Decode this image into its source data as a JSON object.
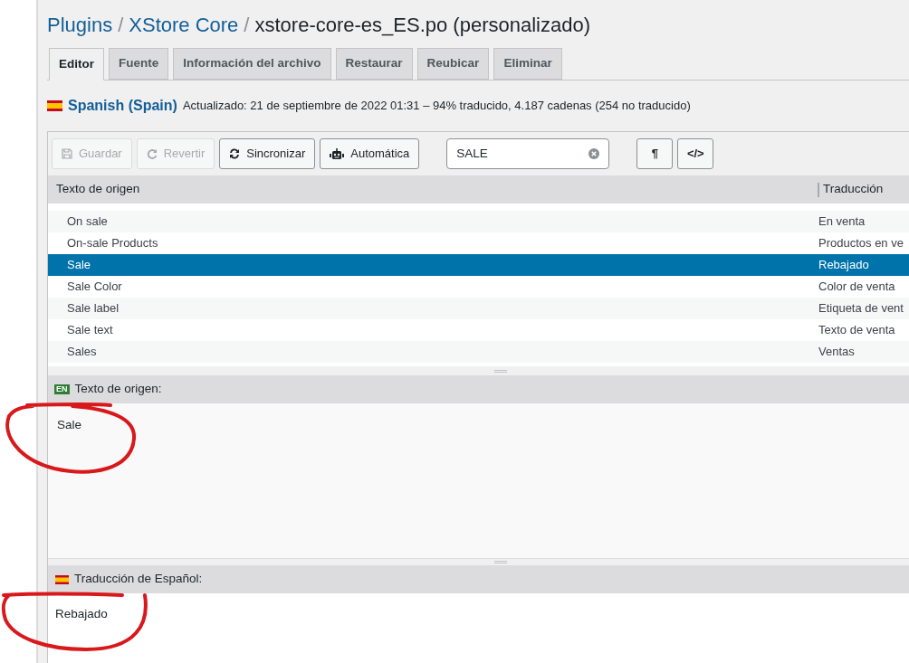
{
  "breadcrumb": [
    {
      "text": "Plugins",
      "kind": "link"
    },
    {
      "text": "/",
      "kind": "separator"
    },
    {
      "text": "XStore Core",
      "kind": "link"
    },
    {
      "text": "/",
      "kind": "separator"
    },
    {
      "text": "xstore-core-es_ES.po (personalizado)",
      "kind": "current"
    }
  ],
  "tabs": [
    {
      "label": "Editor",
      "selected": true
    },
    {
      "label": "Fuente",
      "selected": false
    },
    {
      "label": "Información del archivo",
      "selected": false
    },
    {
      "label": "Restaurar",
      "selected": false
    },
    {
      "label": "Reubicar",
      "selected": false
    },
    {
      "label": "Eliminar",
      "selected": false
    }
  ],
  "locale": {
    "name": "Spanish (Spain)",
    "summary": "Actualizado: 21 de septiembre de 2022 01:31 – 94% traducido, 4.187 cadenas (254 no traducido)"
  },
  "toolbar": {
    "buttons": [
      {
        "label": "Guardar",
        "kind": "save",
        "disabled": true
      },
      {
        "label": "Revertir",
        "kind": "revert",
        "disabled": true
      },
      {
        "label": "Sincronizar",
        "kind": "sync",
        "disabled": false
      },
      {
        "label": "Automática",
        "kind": "robot",
        "disabled": false
      }
    ],
    "search": {
      "value": "SALE"
    },
    "toggles": [
      "¶",
      "</>"
    ]
  },
  "table": {
    "columns": [
      "Texto de origen",
      "Traducción"
    ],
    "rows": [
      {
        "source": "On sale",
        "translation": "En venta",
        "selected": false
      },
      {
        "source": "On-sale Products",
        "translation": "Productos en ve",
        "selected": false
      },
      {
        "source": "Sale",
        "translation": "Rebajado",
        "selected": true
      },
      {
        "source": "Sale Color",
        "translation": "Color de venta",
        "selected": false
      },
      {
        "source": "Sale label",
        "translation": "Etiqueta de vent",
        "selected": false
      },
      {
        "source": "Sale text",
        "translation": "Texto de venta",
        "selected": false
      },
      {
        "source": "Sales",
        "translation": "Ventas",
        "selected": false
      }
    ]
  },
  "source_panel": {
    "badge": "EN",
    "label": "Texto de origen:",
    "text": "Sale"
  },
  "translation_panel": {
    "label": "Traducción de Español:",
    "text": "Rebajado"
  }
}
